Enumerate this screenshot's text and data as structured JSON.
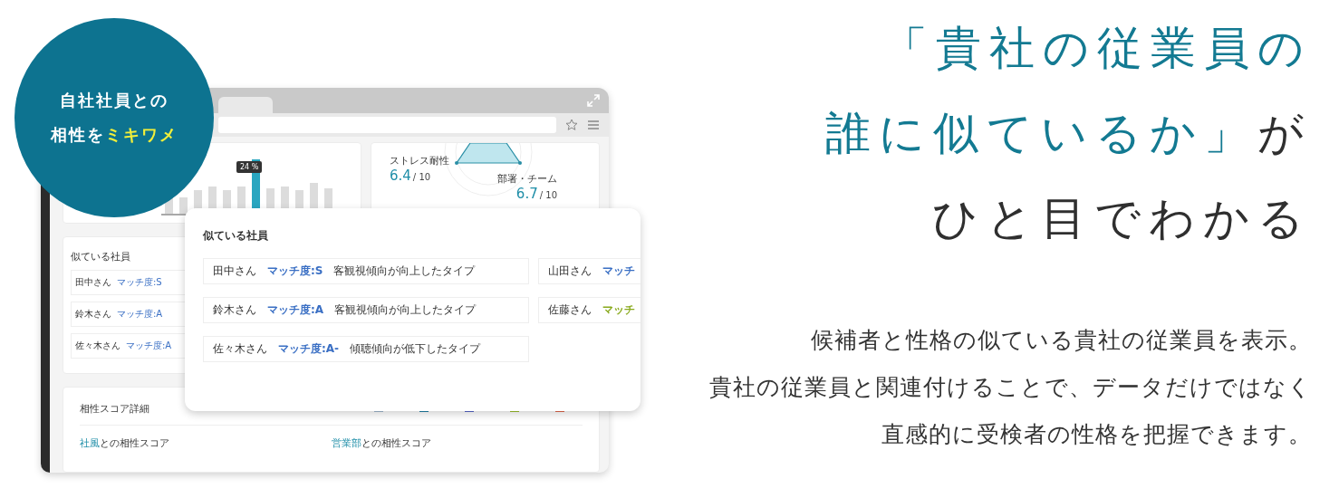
{
  "badge": {
    "line_1": "自社社員との",
    "line_2": "相性を",
    "line_2_highlight": "ミキワメ"
  },
  "mockup": {
    "chart_tooltip": "24 %",
    "scores": [
      {
        "label": "ストレス耐性",
        "value": "6.4",
        "max": "/ 10"
      },
      {
        "label": "部署・チーム",
        "value": "6.7",
        "max": "/ 10"
      }
    ],
    "similar_card": {
      "title": "似ている社員",
      "rows": [
        {
          "name": "田中さん",
          "match": "マッチ度:S"
        },
        {
          "name": "鈴木さん",
          "match": "マッチ度:A"
        },
        {
          "name": "佐々木さん",
          "match": "マッチ度:A"
        }
      ]
    },
    "detail_card": {
      "title": "相性スコア詳細",
      "sections": [
        {
          "accent": "社風",
          "label": "との相性スコア"
        },
        {
          "accent": "営業部",
          "label": "との相性スコア"
        }
      ]
    },
    "popup": {
      "title": "似ている社員",
      "rows": [
        {
          "name": "田中さん",
          "match": "マッチ度:S",
          "type": "客観視傾向が向上したタイプ",
          "color": "#3a6fc4"
        },
        {
          "name": "鈴木さん",
          "match": "マッチ度:A",
          "type": "客観視傾向が向上したタイプ",
          "color": "#3a6fc4"
        },
        {
          "name": "佐々木さん",
          "match": "マッチ度:A-",
          "type": "傾聴傾向が低下したタイプ",
          "color": "#3a6fc4"
        }
      ],
      "side_rows": [
        {
          "name": "山田さん",
          "match": "マッチ",
          "color": "#3a6fc4"
        },
        {
          "name": "佐藤さん",
          "match": "マッチ",
          "color": "#8aaa1e"
        }
      ]
    }
  },
  "headline": [
    [
      {
        "text": "「貴社の従業員の",
        "accent": true
      }
    ],
    [
      {
        "text": "誰に似ているか」",
        "accent": true
      },
      {
        "text": "が",
        "accent": false
      }
    ],
    [
      {
        "text": "ひと目でわかる",
        "accent": false
      }
    ]
  ],
  "description": [
    "候補者と性格の似ている貴社の従業員を表示。",
    "貴社の従業員と関連付けることで、データだけではなく",
    "直感的に受検者の性格を把握できます。"
  ]
}
